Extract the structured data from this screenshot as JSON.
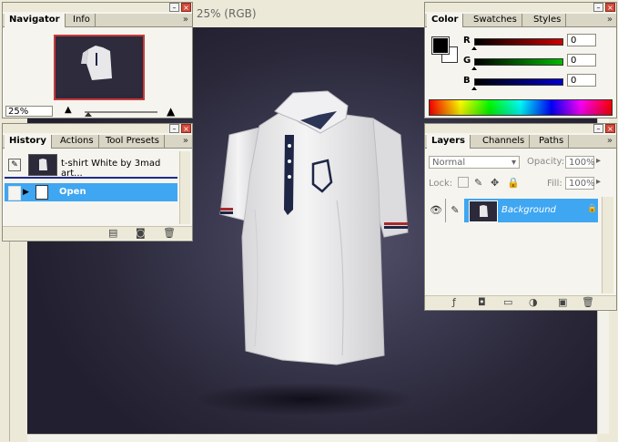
{
  "document": {
    "title_fragment": "@ 25% (RGB)"
  },
  "navigator": {
    "tabs": [
      "Navigator",
      "Info"
    ],
    "zoom": "25%"
  },
  "history": {
    "tabs": [
      "History",
      "Actions",
      "Tool Presets"
    ],
    "snapshot_label": "t-shirt White by 3mad art...",
    "steps": [
      "Open"
    ]
  },
  "color": {
    "tabs": [
      "Color",
      "Swatches",
      "Styles"
    ],
    "channels": [
      {
        "label": "R",
        "value": "0",
        "bar_color": "#cc0000"
      },
      {
        "label": "G",
        "value": "0",
        "bar_color": "#00bb00"
      },
      {
        "label": "B",
        "value": "0",
        "bar_color": "#0000cc"
      }
    ],
    "foreground": "#000000",
    "background": "#ffffff"
  },
  "layers": {
    "tabs": [
      "Layers",
      "Channels",
      "Paths"
    ],
    "blend_mode": "Normal",
    "opacity_label": "Opacity:",
    "opacity": "100%",
    "lock_label": "Lock:",
    "fill_label": "Fill:",
    "fill": "100%",
    "items": [
      {
        "name": "Background"
      }
    ]
  },
  "colors": {
    "selection": "#3fa6f2",
    "nav_frame": "#c83a3a",
    "canvas_bg": "#2a2839"
  }
}
